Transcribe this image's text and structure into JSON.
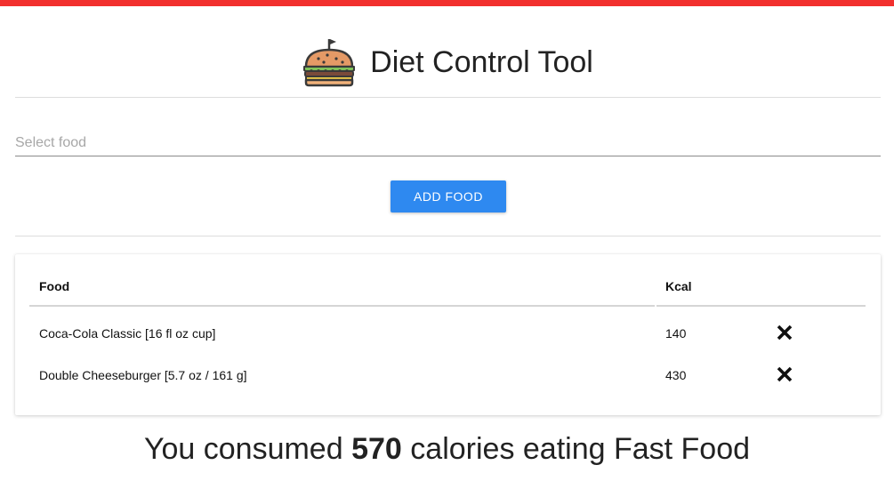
{
  "app": {
    "title": "Diet Control Tool",
    "logo_icon": "burger-icon",
    "accent_color": "#f2302e"
  },
  "form": {
    "food_placeholder": "Select food",
    "food_value": "",
    "add_button_label": "ADD FOOD",
    "button_color": "#2e89f0"
  },
  "table": {
    "headers": {
      "food": "Food",
      "kcal": "Kcal"
    },
    "rows": [
      {
        "food": "Coca-Cola Classic [16 fl oz cup]",
        "kcal": "140",
        "remove_icon": "close-icon"
      },
      {
        "food": "Double Cheeseburger [5.7 oz / 161 g]",
        "kcal": "430",
        "remove_icon": "close-icon"
      }
    ]
  },
  "summary": {
    "prefix": "You consumed",
    "total": "570",
    "suffix": "calories eating Fast Food"
  }
}
